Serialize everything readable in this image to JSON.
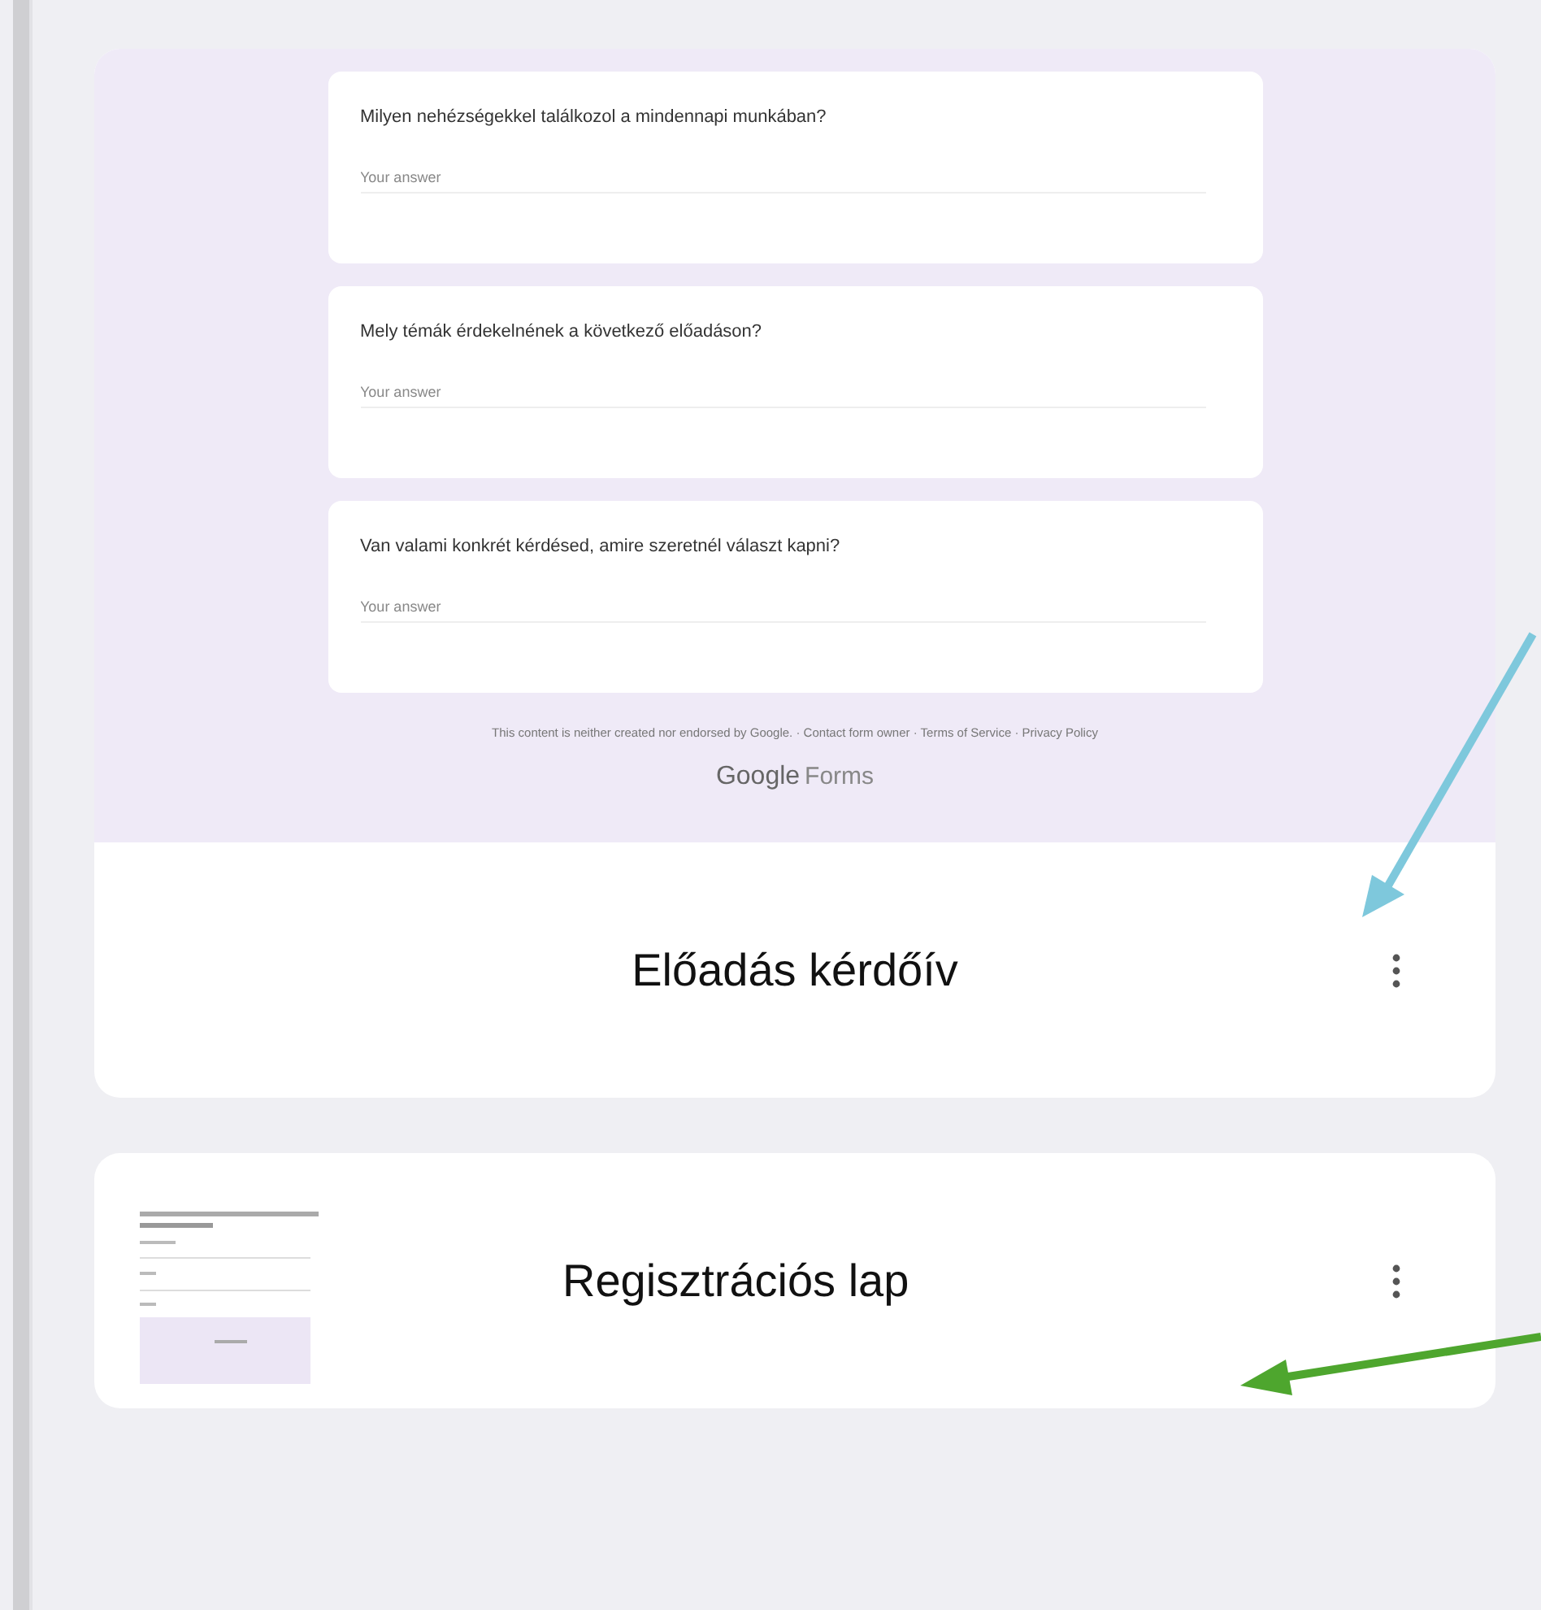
{
  "forms": [
    {
      "kind": "expanded",
      "title": "Előadás kérdőív",
      "questions": [
        {
          "text": "Milyen nehézségekkel találkozol a mindennapi munkában?",
          "placeholder": "Your answer"
        },
        {
          "text": "Mely témák érdekelnének a következő előadáson?",
          "placeholder": "Your answer"
        },
        {
          "text": "Van valami konkrét kérdésed, amire szeretnél választ kapni?",
          "placeholder": "Your answer"
        }
      ],
      "footer": "This content is neither created nor endorsed by Google. · Contact form owner · Terms of Service · Privacy Policy",
      "brand": "Google",
      "brand_product": "Forms"
    },
    {
      "kind": "thumbnail",
      "title": "Regisztrációs lap"
    }
  ],
  "annotations": [
    {
      "color": "#7ec8dc"
    },
    {
      "color": "#4ea62e"
    }
  ]
}
